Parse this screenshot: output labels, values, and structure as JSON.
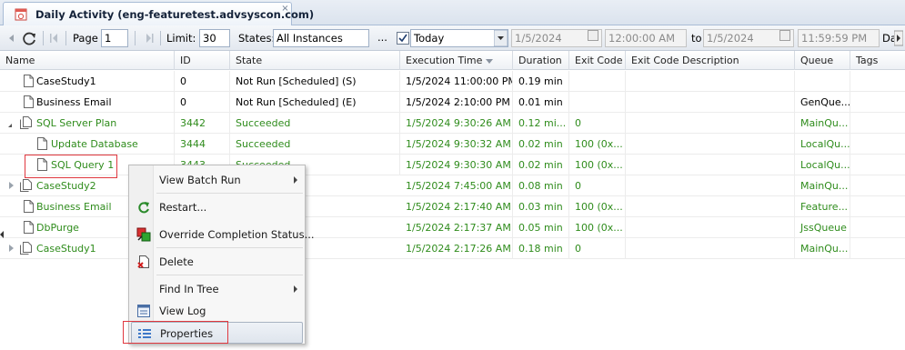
{
  "tab": {
    "title": "Daily Activity (eng-featuretest.advsyscon.com)",
    "close": "×"
  },
  "toolbar": {
    "page_label": "Page",
    "page_value": "1",
    "limit_label": "Limit:",
    "limit_value": "30",
    "states_label": "States:",
    "states_value": "All Instances",
    "ellipsis": "...",
    "date_filter": "Today",
    "from_date": "1/5/2024",
    "from_time": "12:00:00 AM",
    "to_label": "to",
    "to_date": "1/5/2024",
    "to_time": "11:59:59 PM",
    "cut_label": "Da"
  },
  "columns": [
    "Name",
    "ID",
    "State",
    "Execution Time",
    "Duration",
    "Exit Code",
    "Exit Code Description",
    "Queue",
    "Tags"
  ],
  "rows": [
    {
      "name": "CaseStudy1",
      "id": "0",
      "state": "Not Run [Scheduled] (S)",
      "exec": "1/5/2024 11:00:00 PM",
      "duration": "0.19 min",
      "exit": "",
      "desc": "",
      "queue": ""
    },
    {
      "name": "Business Email",
      "id": "0",
      "state": "Not Run [Scheduled] (E)",
      "exec": "1/5/2024 2:10:00 PM",
      "duration": "0.01 min",
      "exit": "",
      "desc": "",
      "queue": "GenQue..."
    },
    {
      "name": "SQL Server Plan",
      "id": "3442",
      "state": "Succeeded",
      "exec": "1/5/2024 9:30:26 AM",
      "duration": "0.12 mi...",
      "exit": "0",
      "desc": "",
      "queue": "MainQu..."
    },
    {
      "name": "Update Database",
      "id": "3444",
      "state": "Succeeded",
      "exec": "1/5/2024 9:30:32 AM",
      "duration": "0.02 min",
      "exit": "100 (0x...",
      "desc": "",
      "queue": "LocalQu..."
    },
    {
      "name": "SQL Query 1",
      "id": "3443",
      "state": "Succeeded",
      "exec": "1/5/2024 9:30:30 AM",
      "duration": "0.02 min",
      "exit": "100 (0x...",
      "desc": "",
      "queue": "LocalQu..."
    },
    {
      "name": "CaseStudy2",
      "id": "",
      "state": "",
      "exec": "1/5/2024 7:45:00 AM",
      "duration": "0.08 min",
      "exit": "0",
      "desc": "",
      "queue": "MainQu..."
    },
    {
      "name": "Business Email",
      "id": "",
      "state": "",
      "exec": "1/5/2024 2:17:40 AM",
      "duration": "0.03 min",
      "exit": "100 (0x...",
      "desc": "",
      "queue": "Feature..."
    },
    {
      "name": "DbPurge",
      "id": "",
      "state": "",
      "exec": "1/5/2024 2:17:37 AM",
      "duration": "0.05 min",
      "exit": "100 (0x...",
      "desc": "",
      "queue": "JssQueue"
    },
    {
      "name": "CaseStudy1",
      "id": "",
      "state": "",
      "exec": "1/5/2024 2:17:26 AM",
      "duration": "0.18 min",
      "exit": "0",
      "desc": "",
      "queue": "MainQu..."
    }
  ],
  "context_menu": {
    "items": [
      "View Batch Run",
      "Restart...",
      "Override Completion Status...",
      "Delete",
      "Find In Tree",
      "View Log",
      "Properties"
    ]
  },
  "colors": {
    "succeeded_text": "#2f8c1c",
    "highlight_box": "#e0383f"
  }
}
